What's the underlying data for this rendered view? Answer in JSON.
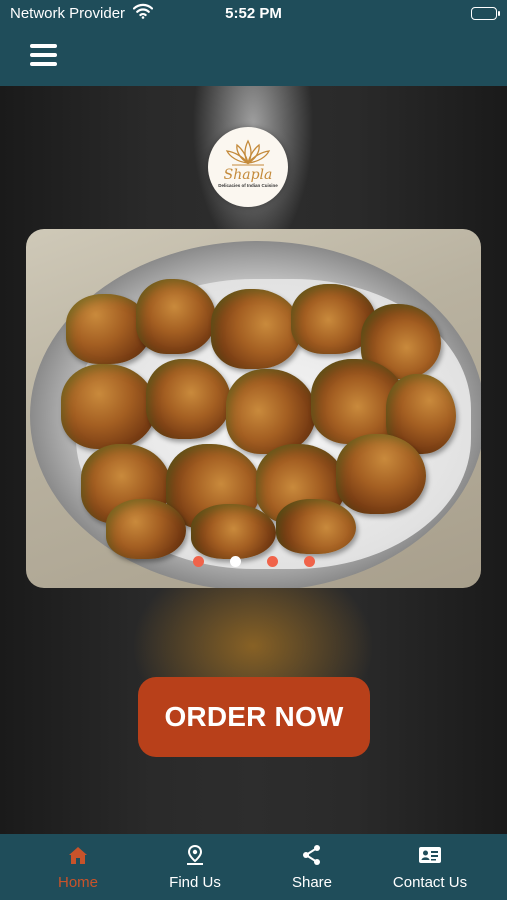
{
  "status_bar": {
    "carrier": "Network Provider",
    "time": "5:52 PM"
  },
  "header": {
    "menu_icon": "hamburger-menu-icon"
  },
  "logo": {
    "brand": "Shapla",
    "tagline": "Delicacies of Indian Cuisine"
  },
  "carousel": {
    "slide_count": 4,
    "active_index": 1,
    "dot_active_color": "#ffffff",
    "dot_inactive_color": "#f0634a"
  },
  "cta": {
    "label": "ORDER NOW",
    "color": "#b8401a"
  },
  "tabbar": {
    "items": [
      {
        "label": "Home",
        "icon": "home-icon",
        "active": true
      },
      {
        "label": "Find Us",
        "icon": "location-pin-icon",
        "active": false
      },
      {
        "label": "Share",
        "icon": "share-icon",
        "active": false
      },
      {
        "label": "Contact Us",
        "icon": "contact-card-icon",
        "active": false
      }
    ],
    "active_color": "#c8532a",
    "inactive_color": "#ffffff",
    "background": "#1f4d5a"
  }
}
